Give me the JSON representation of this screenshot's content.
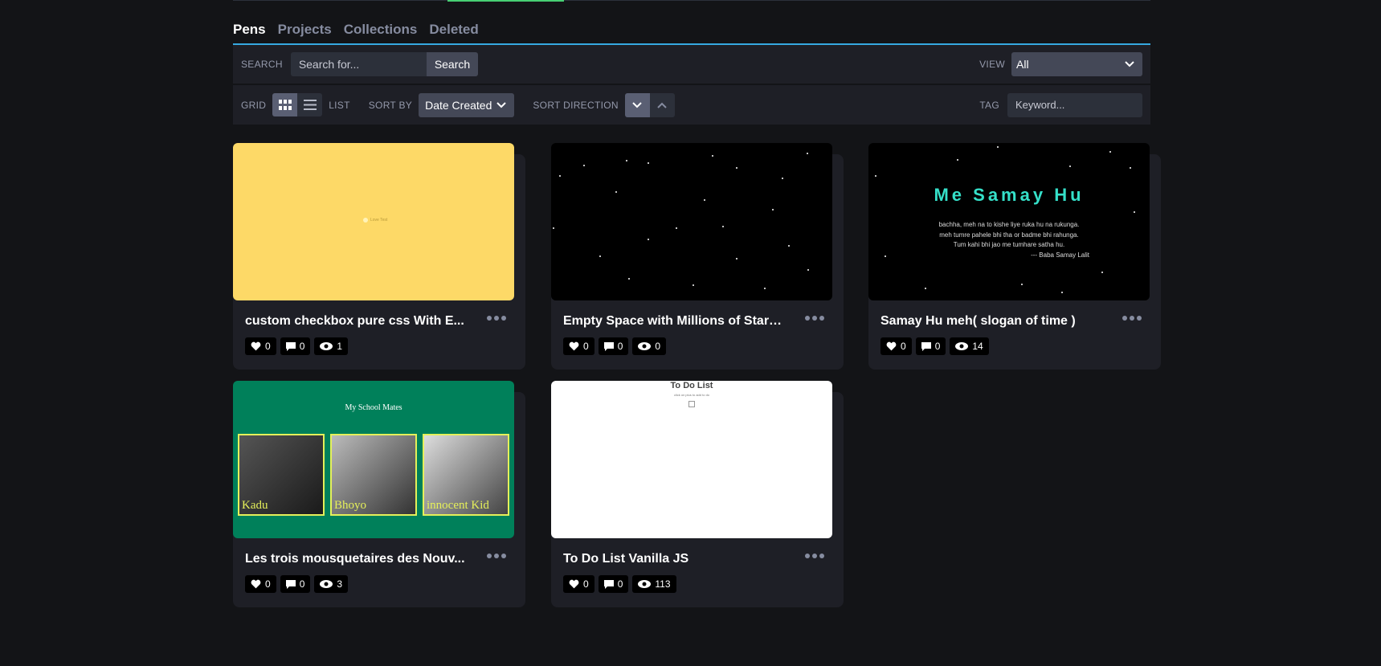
{
  "tabs": [
    "Pens",
    "Projects",
    "Collections",
    "Deleted"
  ],
  "search": {
    "label": "SEARCH",
    "placeholder": "Search for...",
    "button": "Search"
  },
  "view": {
    "label": "VIEW",
    "value": "All"
  },
  "layout": {
    "grid_label": "GRID",
    "list_label": "LIST"
  },
  "sort": {
    "label": "SORT BY",
    "value": "Date Created",
    "direction_label": "SORT DIRECTION"
  },
  "tag": {
    "label": "TAG",
    "placeholder": "Keyword..."
  },
  "pens": [
    {
      "title": "custom checkbox pure css With E...",
      "likes": "0",
      "comments": "0",
      "views": "1",
      "preview_text": "Love Test"
    },
    {
      "title": "Empty Space with Millions of Stars...",
      "likes": "0",
      "comments": "0",
      "views": "0"
    },
    {
      "title": "Samay Hu meh( slogan of time )",
      "likes": "0",
      "comments": "0",
      "views": "14",
      "preview_heading": "Me Samay Hu",
      "preview_lines": [
        "bachha, meh na to kishe liye ruka hu na rukunga.",
        "meh tumre pahele bhi tha or badme bhi rahunga.",
        "Tum kahi bhi jao me tumhare satha hu."
      ],
      "preview_signature": "--- Baba Samay Lalit"
    },
    {
      "title": "Les trois mousquetaires des Nouv...",
      "likes": "0",
      "comments": "0",
      "views": "3",
      "preview_heading": "My School Mates",
      "preview_names": [
        "Kadu",
        "Bhoyo",
        "innocent Kid"
      ]
    },
    {
      "title": "To Do List Vanilla JS",
      "likes": "0",
      "comments": "0",
      "views": "113",
      "preview_heading": "To Do List",
      "preview_sub": "click on plus to add to do"
    }
  ],
  "colors": {
    "accent_tab": "#36a9e1",
    "accent_top": "#47cf73",
    "card_bg": "#1e1f26",
    "page_bg": "#131417"
  }
}
